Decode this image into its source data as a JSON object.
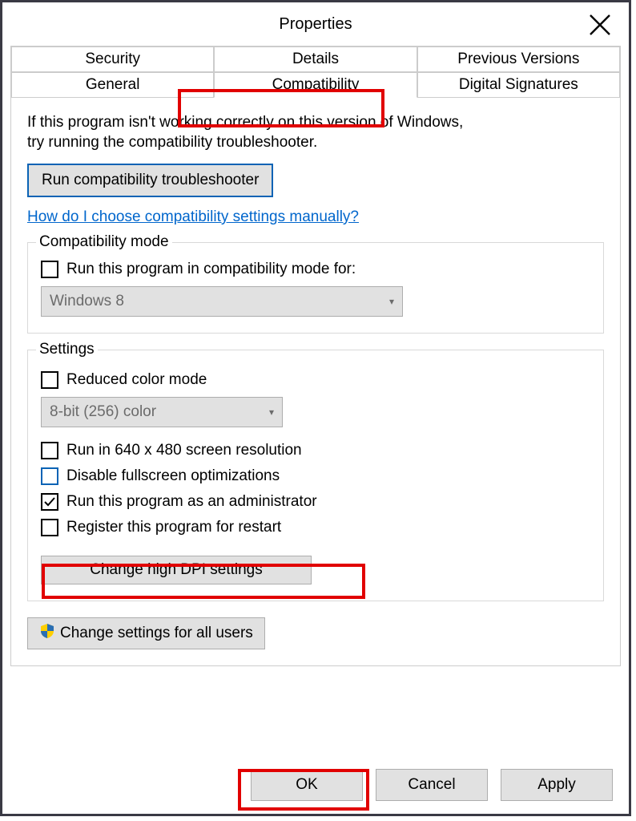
{
  "title": "Properties",
  "tabs_row1": [
    "Security",
    "Details",
    "Previous Versions"
  ],
  "tabs_row2": [
    "General",
    "Compatibility",
    "Digital Signatures"
  ],
  "active_tab": "Compatibility",
  "intro_line1": "If this program isn't working correctly on this version of Windows,",
  "intro_line2": "try running the compatibility troubleshooter.",
  "troubleshoot_btn": "Run compatibility troubleshooter",
  "manual_link": "How do I choose compatibility settings manually?",
  "compat_mode": {
    "legend": "Compatibility mode",
    "checkbox_label": "Run this program in compatibility mode for:",
    "combo_value": "Windows 8"
  },
  "settings": {
    "legend": "Settings",
    "reduced_color": "Reduced color mode",
    "color_combo": "8-bit (256) color",
    "run_640": "Run in 640 x 480 screen resolution",
    "disable_fullscreen": "Disable fullscreen optimizations",
    "run_admin": "Run this program as an administrator",
    "register_restart": "Register this program for restart",
    "dpi_btn": "Change high DPI settings"
  },
  "all_users_btn": "Change settings for all users",
  "footer": {
    "ok": "OK",
    "cancel": "Cancel",
    "apply": "Apply"
  }
}
